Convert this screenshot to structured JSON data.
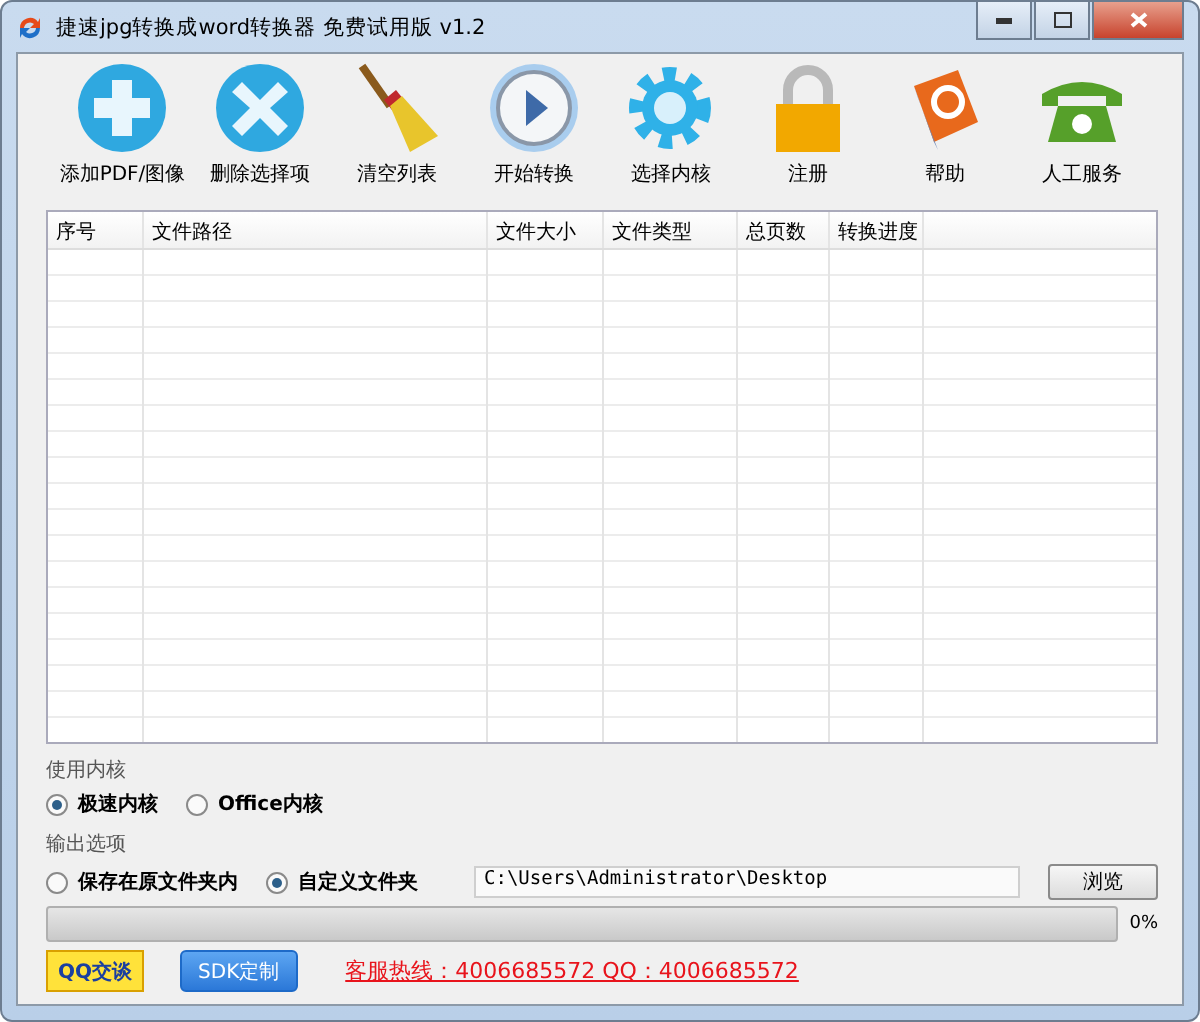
{
  "window": {
    "title": "捷速jpg转换成word转换器 免费试用版 v1.2"
  },
  "toolbar": [
    {
      "kind": "add",
      "label": "添加PDF/图像"
    },
    {
      "kind": "delete",
      "label": "删除选择项"
    },
    {
      "kind": "clear",
      "label": "清空列表"
    },
    {
      "kind": "start",
      "label": "开始转换"
    },
    {
      "kind": "engine",
      "label": "选择内核"
    },
    {
      "kind": "register",
      "label": "注册"
    },
    {
      "kind": "help",
      "label": "帮助"
    },
    {
      "kind": "service",
      "label": "人工服务"
    }
  ],
  "table": {
    "columns": [
      "序号",
      "文件路径",
      "文件大小",
      "文件类型",
      "总页数",
      "转换进度"
    ]
  },
  "engine": {
    "label": "使用内核",
    "options": [
      {
        "label": "极速内核",
        "selected": true
      },
      {
        "label": "Office内核",
        "selected": false
      }
    ]
  },
  "output": {
    "label": "输出选项",
    "options": [
      {
        "label": "保存在原文件夹内",
        "selected": false
      },
      {
        "label": "自定义文件夹",
        "selected": true
      }
    ],
    "path": "C:\\Users\\Administrator\\Desktop",
    "browse": "浏览"
  },
  "progress": {
    "level": 0,
    "reading": "0%"
  },
  "footer": {
    "qq_button": "QQ交谈",
    "sdk_button": "SDK定制",
    "hotline": "客服热线：4006685572 QQ：4006685572"
  }
}
